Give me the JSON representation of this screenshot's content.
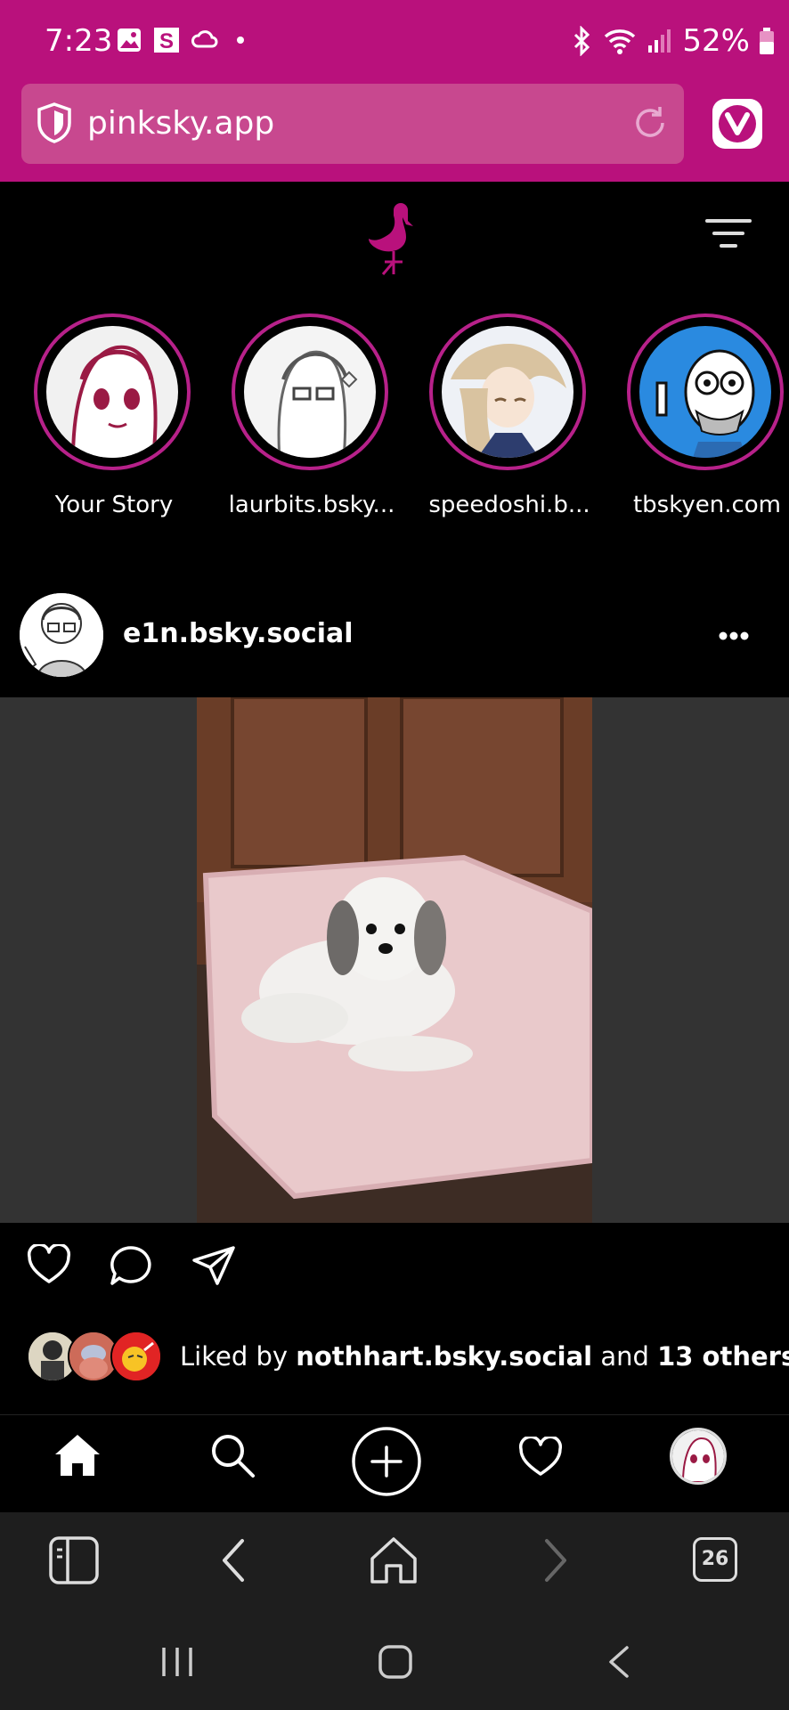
{
  "status_bar": {
    "time": "7:23",
    "battery": "52%",
    "icons_left": [
      "gallery-icon",
      "s-app-icon",
      "cloud-icon",
      "dot-icon"
    ],
    "icons_right": [
      "bluetooth-icon",
      "wifi-icon",
      "signal-icon",
      "battery-icon"
    ]
  },
  "browser": {
    "url": "pinksky.app",
    "tabs_count": "26"
  },
  "app": {
    "logo": "flamingo-logo-icon",
    "stories": [
      {
        "label": "Your Story"
      },
      {
        "label": "laurbits.bsky..."
      },
      {
        "label": "speedoshi.b..."
      },
      {
        "label": "tbskyen.com"
      }
    ],
    "post": {
      "username": "e1n.bsky.social",
      "likes_prefix": "Liked by ",
      "liked_by_user": "nothhart.bsky.social",
      "likes_middle": " and ",
      "likes_others": "13 others"
    }
  },
  "colors": {
    "accent": "#b9117c",
    "story_ring": "#b7218a",
    "background": "#000000"
  }
}
